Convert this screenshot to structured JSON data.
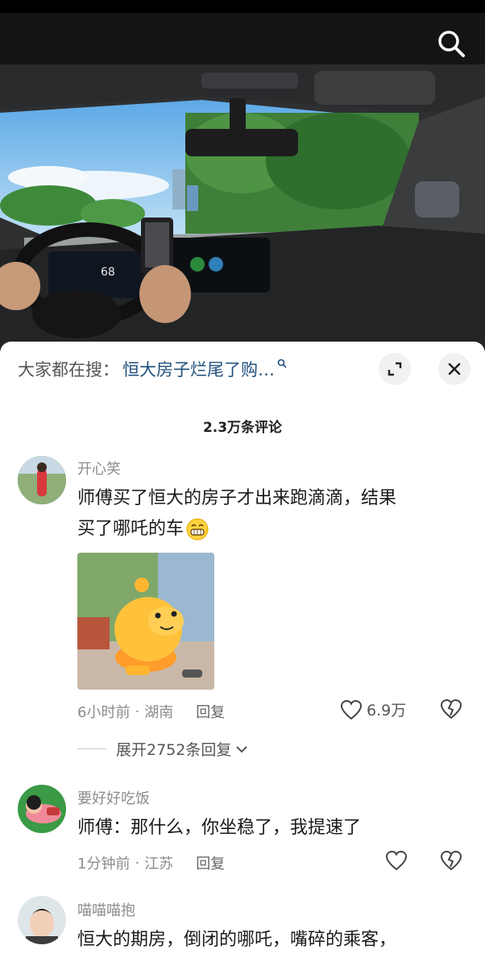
{
  "top": {
    "search_icon": "search-icon"
  },
  "hot_search": {
    "label": "大家都在搜：",
    "query": "恒大房子烂尾了购…",
    "mark_icon": "search-mini-icon",
    "expand_icon": "expand-icon",
    "close_icon": "close-icon"
  },
  "comments_count": "2.3万条评论",
  "comments": [
    {
      "user": "开心笑",
      "text_lines": [
        "师傅买了恒大的房子才出来跑滴滴，结果",
        "买了哪吒的车"
      ],
      "emoji": "grin-emoji",
      "has_sticker": true,
      "time": "6小时前",
      "location": "湖南",
      "reply": "回复",
      "likes": "6.9万",
      "expand_replies": "展开2752条回复"
    },
    {
      "user": "要好好吃饭",
      "text": "师傅：那什么，你坐稳了，我提速了",
      "time": "1分钟前",
      "location": "江苏",
      "reply": "回复"
    },
    {
      "user": "喵喵喵抱",
      "text": "恒大的期房，倒闭的哪吒，嘴碎的乘客，"
    }
  ],
  "colors": {
    "link_blue": "#1f4f7a",
    "meta_gray": "#8c8c8c",
    "top_bar": "#141414"
  }
}
